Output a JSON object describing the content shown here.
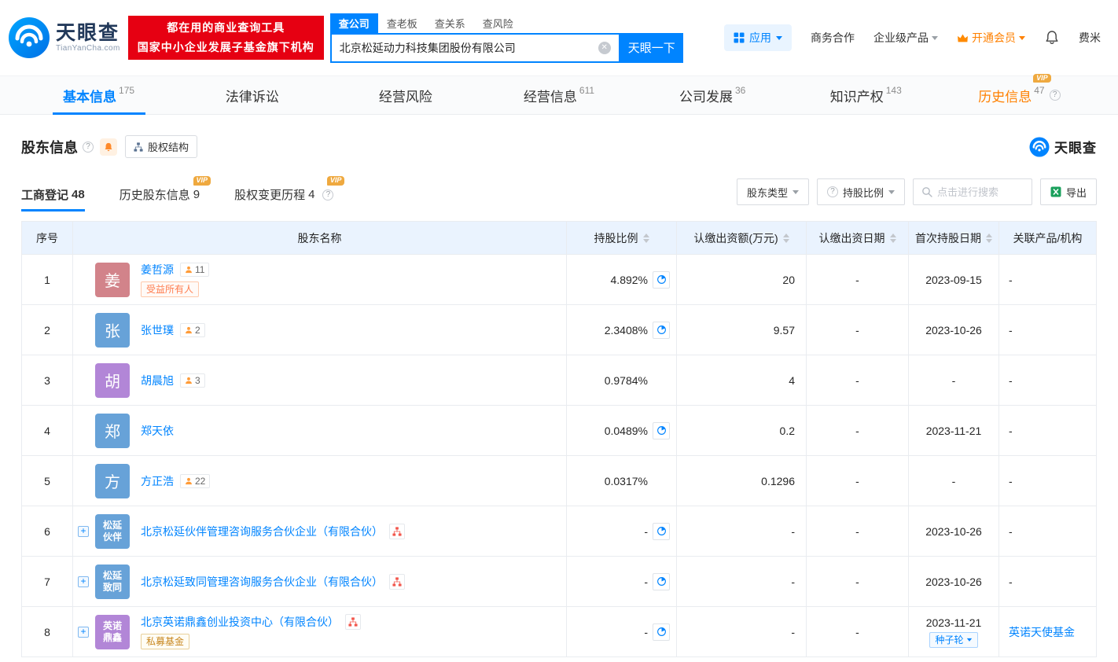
{
  "colors": {
    "brand_blue": "#0084ff",
    "banner_red": "#e60012",
    "vip_orange": "#ff8000",
    "table_header_bg": "#eaf3fe"
  },
  "header": {
    "brand": "天眼查",
    "brand_domain": "TianYanCha.com",
    "slogan_line1": "都在用的商业查询工具",
    "slogan_line2": "国家中小企业发展子基金旗下机构",
    "search_tabs": [
      "查公司",
      "查老板",
      "查关系",
      "查风险"
    ],
    "search_value": "北京松延动力科技集团股份有限公司",
    "search_button": "天眼一下",
    "apps": "应用",
    "cooperation": "商务合作",
    "enterprise": "企业级产品",
    "vip": "开通会员",
    "user": "费米"
  },
  "nav_tabs": [
    {
      "label": "基本信息",
      "count": "175"
    },
    {
      "label": "法律诉讼",
      "count": ""
    },
    {
      "label": "经营风险",
      "count": ""
    },
    {
      "label": "经营信息",
      "count": "611"
    },
    {
      "label": "公司发展",
      "count": "36"
    },
    {
      "label": "知识产权",
      "count": "143"
    },
    {
      "label": "历史信息",
      "count": "47",
      "vip": "VIP"
    }
  ],
  "section": {
    "title": "股东信息",
    "equity_structure": "股权结构",
    "watermark": "天眼查",
    "sub_tabs": [
      {
        "label": "工商登记",
        "count": "48"
      },
      {
        "label": "历史股东信息",
        "count": "9",
        "vip": "VIP"
      },
      {
        "label": "股权变更历程",
        "count": "4",
        "vip": "VIP"
      }
    ],
    "filter_type": "股东类型",
    "filter_ratio": "持股比例",
    "search_placeholder": "点击进行搜索",
    "export": "导出"
  },
  "table": {
    "columns": [
      "序号",
      "股东名称",
      "持股比例",
      "认缴出资额(万元)",
      "认缴出资日期",
      "首次持股日期",
      "关联产品/机构"
    ],
    "rows": [
      {
        "no": "1",
        "avatar": "姜",
        "avatar_color": "#d2838a",
        "name": "姜哲源",
        "partner_count": "11",
        "tag": "受益所有人",
        "ratio": "4.892%",
        "amount": "20",
        "sub_date": "-",
        "first_date": "2023-09-15",
        "related": "-"
      },
      {
        "no": "2",
        "avatar": "张",
        "avatar_color": "#67a2d8",
        "name": "张世璞",
        "partner_count": "2",
        "ratio": "2.3408%",
        "amount": "9.57",
        "sub_date": "-",
        "first_date": "2023-10-26",
        "related": "-"
      },
      {
        "no": "3",
        "avatar": "胡",
        "avatar_color": "#b286d7",
        "name": "胡晨旭",
        "partner_count": "3",
        "ratio": "0.9784%",
        "amount": "4",
        "sub_date": "-",
        "first_date": "-",
        "related": "-"
      },
      {
        "no": "4",
        "avatar": "郑",
        "avatar_color": "#67a2d8",
        "name": "郑天依",
        "ratio": "0.0489%",
        "amount": "0.2",
        "sub_date": "-",
        "first_date": "2023-11-21",
        "related": "-"
      },
      {
        "no": "5",
        "avatar": "方",
        "avatar_color": "#67a2d8",
        "name": "方正浩",
        "partner_count": "22",
        "ratio": "0.0317%",
        "amount": "0.1296",
        "sub_date": "-",
        "first_date": "-",
        "related": "-"
      },
      {
        "no": "6",
        "avatar_line1": "松延",
        "avatar_line2": "伙伴",
        "avatar_color": "#67a2d8",
        "name": "北京松延伙伴管理咨询服务合伙企业（有限合伙）",
        "ratio": "-",
        "amount": "-",
        "sub_date": "-",
        "first_date": "2023-10-26",
        "related": "-"
      },
      {
        "no": "7",
        "avatar_line1": "松延",
        "avatar_line2": "致同",
        "avatar_color": "#67a2d8",
        "name": "北京松延致同管理咨询服务合伙企业（有限合伙）",
        "ratio": "-",
        "amount": "-",
        "sub_date": "-",
        "first_date": "2023-10-26",
        "related": "-"
      },
      {
        "no": "8",
        "avatar_line1": "英诺",
        "avatar_line2": "鼎鑫",
        "avatar_color": "#b286d7",
        "name": "北京英诺鼎鑫创业投资中心（有限合伙）",
        "tag": "私募基金",
        "ratio": "-",
        "amount": "-",
        "sub_date": "-",
        "first_date": "2023-11-21",
        "round_tag": "种子轮",
        "related_link": "英诺天使基金"
      }
    ]
  }
}
